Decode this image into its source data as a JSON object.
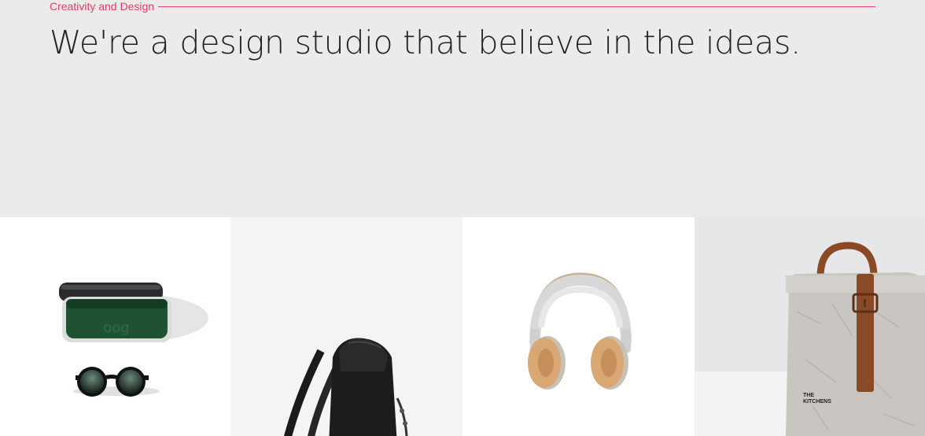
{
  "hero": {
    "eyebrow": "Creativity and Design",
    "headline": "We're a design studio that believe in the ideas."
  },
  "gallery": {
    "items": [
      {
        "icon": "glasses-case-and-sunglasses-image",
        "case_logo": "oog"
      },
      {
        "icon": "black-backpack-image"
      },
      {
        "icon": "headphones-image"
      },
      {
        "icon": "paper-lunch-bag-image",
        "bag_label": [
          "THE",
          "KITCHENS"
        ]
      }
    ]
  },
  "colors": {
    "accent": "#e83e63",
    "hero_background": "#ebebeb",
    "headline_text": "#222222"
  }
}
